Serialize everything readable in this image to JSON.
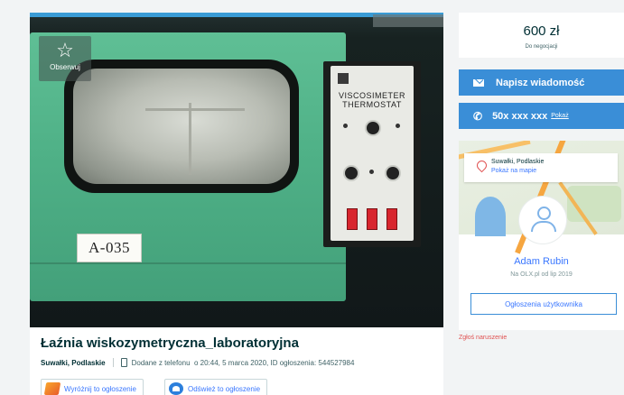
{
  "listing": {
    "watch_label": "Obserwuj",
    "title": "Łaźnia wiskozymetryczna_laboratoryjna",
    "location": "Suwałki, Podlaskie",
    "added": "Dodane z telefonu",
    "datetime_id": "o 20:44, 5 marca 2020, ID ogłoszenia: 544527984",
    "promote_label": "Wyróżnij to ogłoszenie",
    "refresh_label": "Odśwież to ogłoszenie"
  },
  "photo": {
    "label_tag": "A-035",
    "panel_line1": "VISCOSIMETER",
    "panel_line2": "THERMOSTAT"
  },
  "sidebar": {
    "price": "600 zł",
    "negotiable": "Do negocjacji",
    "message_button": "Napisz wiadomość",
    "phone": "50x xxx xxx",
    "show_phone": "Pokaż",
    "map_location": "Suwałki, Podlaskie",
    "map_link": "Pokaż na mapie",
    "seller_name": "Adam Rubin",
    "seller_since": "Na OLX.pl od lip 2019",
    "user_ads_button": "Ogłoszenia użytkownika",
    "report": "Zgłoś naruszenie"
  },
  "colors": {
    "brand_blue": "#3a8ed7",
    "link_blue": "#3a77ff",
    "text_dark": "#002f34",
    "report_red": "#e05252"
  }
}
